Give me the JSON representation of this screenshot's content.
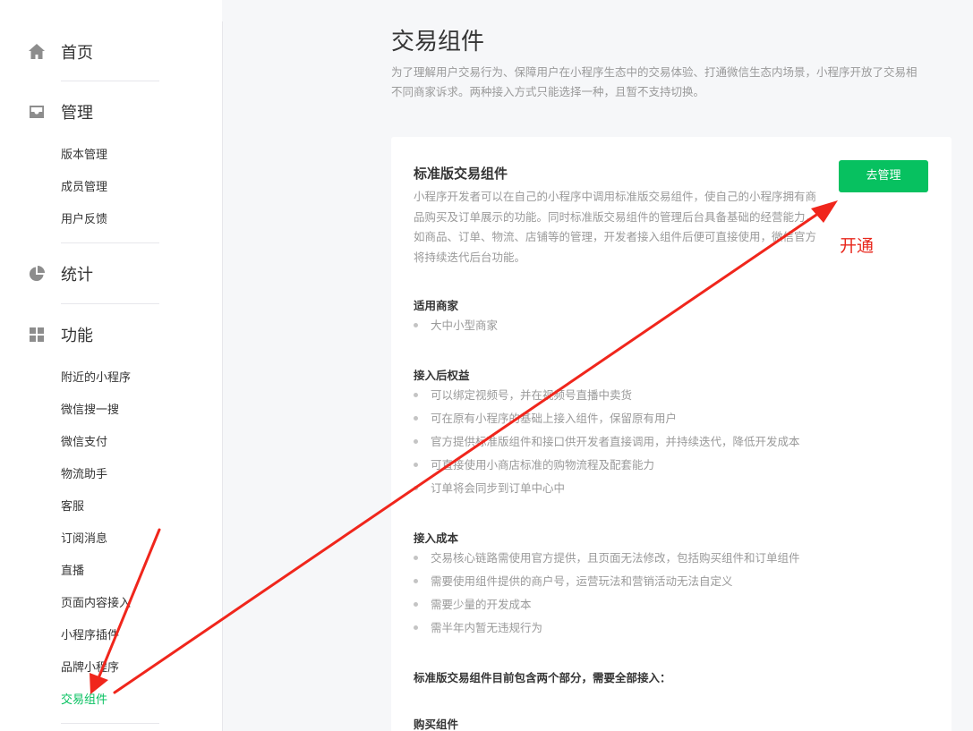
{
  "sidebar": {
    "home": {
      "label": "首页",
      "icon": "home-icon"
    },
    "manage": {
      "label": "管理",
      "icon": "inbox-icon",
      "items": [
        "版本管理",
        "成员管理",
        "用户反馈"
      ]
    },
    "stats": {
      "label": "统计",
      "icon": "pie-chart-icon"
    },
    "features": {
      "label": "功能",
      "icon": "grid-icon",
      "items": [
        "附近的小程序",
        "微信搜一搜",
        "微信支付",
        "物流助手",
        "客服",
        "订阅消息",
        "直播",
        "页面内容接入",
        "小程序插件",
        "品牌小程序",
        "交易组件"
      ],
      "active": "交易组件"
    }
  },
  "main": {
    "title": "交易组件",
    "desc_line1": "为了理解用户交易行为、保障用户在小程序生态中的交易体验、打通微信生态内场景，小程序开放了交易相",
    "desc_line2": "不同商家诉求。两种接入方式只能选择一种，且暂不支持切换。"
  },
  "card": {
    "title": "标准版交易组件",
    "desc": "小程序开发者可以在自己的小程序中调用标准版交易组件，使自己的小程序拥有商品购买及订单展示的功能。同时标准版交易组件的管理后台具备基础的经营能力，如商品、订单、物流、店铺等的管理，开发者接入组件后便可直接使用，微信官方将持续迭代后台功能。",
    "button": "去管理",
    "sections": [
      {
        "title": "适用商家",
        "items": [
          "大中小型商家"
        ]
      },
      {
        "title": "接入后权益",
        "items": [
          "可以绑定视频号，并在视频号直播中卖货",
          "可在原有小程序的基础上接入组件，保留原有用户",
          "官方提供标准版组件和接口供开发者直接调用，并持续迭代，降低开发成本",
          "可直接使用小商店标准的购物流程及配套能力",
          "订单将会同步到订单中心中"
        ]
      },
      {
        "title": "接入成本",
        "items": [
          "交易核心链路需使用官方提供，且页面无法修改，包括购买组件和订单组件",
          "需要使用组件提供的商户号，运营玩法和营销活动无法自定义",
          "需要少量的开发成本",
          "需半年内暂无违规行为"
        ]
      }
    ],
    "note": "标准版交易组件目前包含两个部分，需要全部接入：",
    "next_section": "购买组件"
  },
  "annotation": {
    "text": "开通",
    "color": "#e8271c"
  },
  "colors": {
    "accent": "#07c160",
    "muted": "#9a9a9a",
    "text": "#353535"
  }
}
